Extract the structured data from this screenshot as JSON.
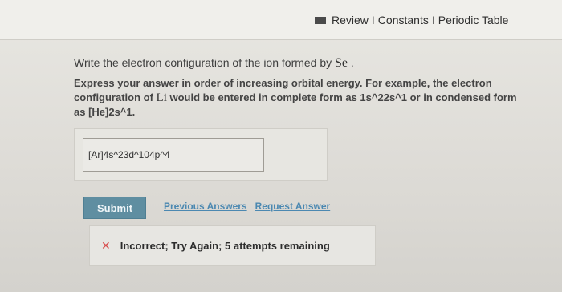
{
  "header": {
    "review_label": "Review",
    "separator": "I",
    "constants_label": "Constants",
    "periodic_table_label": "Periodic Table"
  },
  "question": {
    "prompt_prefix": "Write the electron configuration of the ion formed by ",
    "element": "Se",
    "prompt_suffix": " .",
    "instruction_prefix": "Express your answer in order of increasing orbital energy. For example, the electron configuration of ",
    "example_element": "Li",
    "instruction_suffix": " would be entered in complete form as 1s^22s^1 or in condensed form as [He]2s^1."
  },
  "answer": {
    "value": "[Ar]4s^23d^104p^4"
  },
  "actions": {
    "submit_label": "Submit",
    "previous_answers_label": "Previous Answers",
    "request_answer_label": "Request Answer"
  },
  "feedback": {
    "status_icon": "x-icon",
    "message": "Incorrect; Try Again; 5 attempts remaining"
  },
  "colors": {
    "submit_button": "#5f8ea1",
    "link": "#4b88b1",
    "error": "#d84d4d"
  }
}
